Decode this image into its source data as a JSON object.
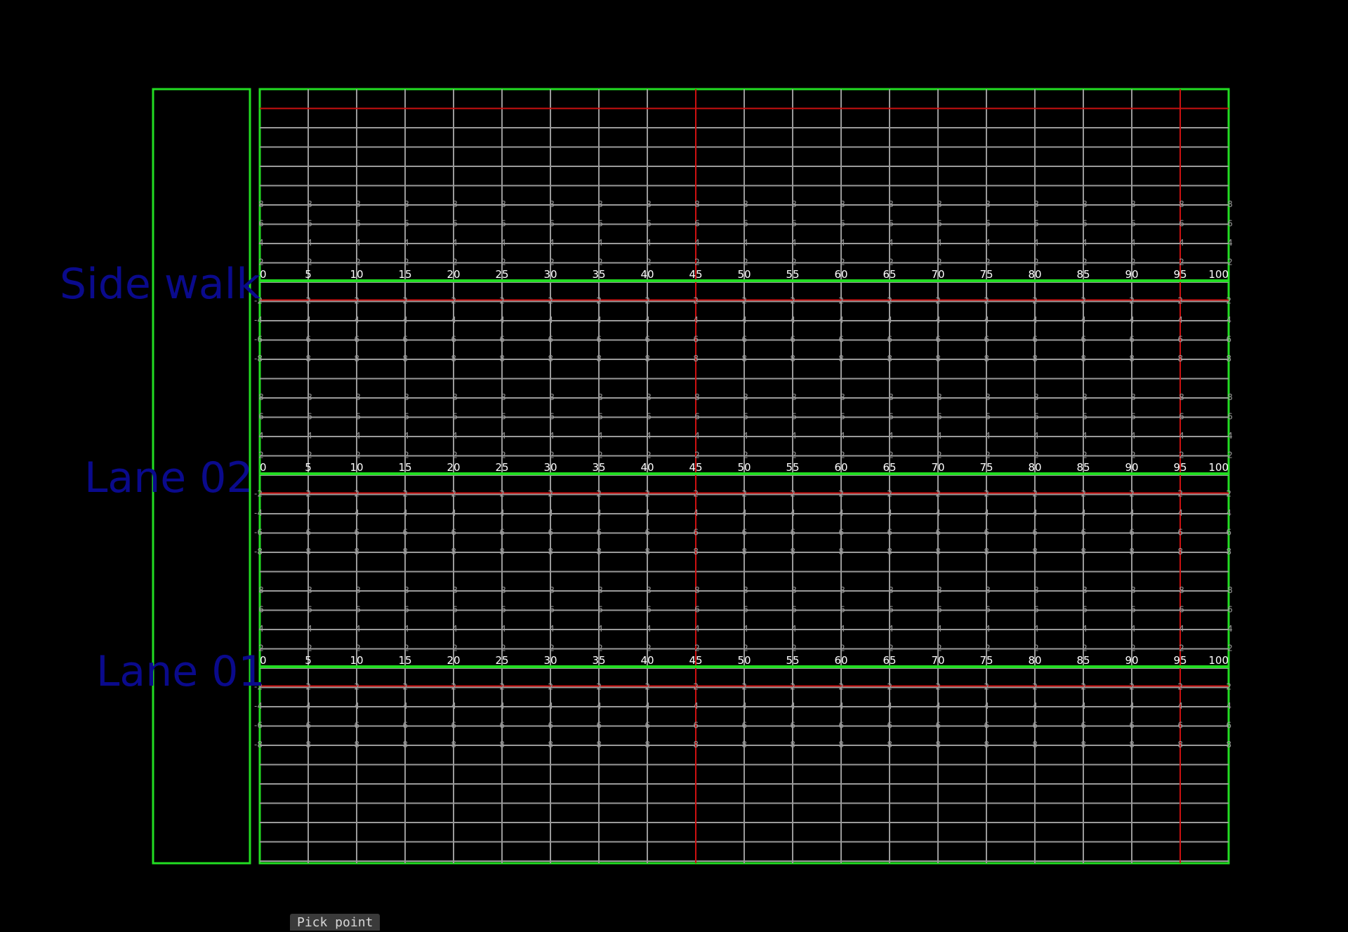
{
  "lanes": [
    {
      "name": "Side walk",
      "x_ticks": [
        "0",
        "5",
        "10",
        "15",
        "20",
        "25",
        "30",
        "35",
        "40",
        "45",
        "50",
        "55",
        "60",
        "65",
        "70",
        "75",
        "80",
        "85",
        "90",
        "95",
        "100"
      ]
    },
    {
      "name": "Lane 02",
      "x_ticks": [
        "0",
        "5",
        "10",
        "15",
        "20",
        "25",
        "30",
        "35",
        "40",
        "45",
        "50",
        "55",
        "60",
        "65",
        "70",
        "75",
        "80",
        "85",
        "90",
        "95",
        "100"
      ]
    },
    {
      "name": "Lane 01",
      "x_ticks": [
        "0",
        "5",
        "10",
        "15",
        "20",
        "25",
        "30",
        "35",
        "40",
        "45",
        "50",
        "55",
        "60",
        "65",
        "70",
        "75",
        "80",
        "85",
        "90",
        "95",
        "100"
      ]
    }
  ],
  "y_ticks_above": [
    "8",
    "6",
    "4",
    "2"
  ],
  "y_ticks_below": [
    "-2",
    "-4",
    "-6",
    "-8"
  ],
  "red_marker_x_values": [
    45,
    95
  ],
  "buttons": {
    "pick_point": "Pick point"
  },
  "colors": {
    "background": "#000000",
    "frame": "#22dd22",
    "grid": "#9a9a9a",
    "marker": "#cc1111",
    "label": "#0a0a8c",
    "tick_text": "#ffffff"
  }
}
